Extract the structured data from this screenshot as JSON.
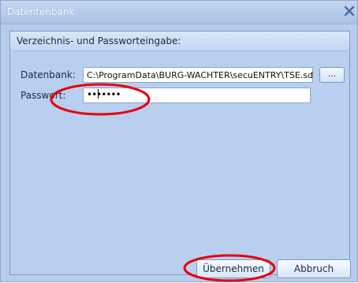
{
  "window": {
    "title": "Datentenbank",
    "close_icon": "close-icon"
  },
  "group": {
    "title": "Verzeichnis- und Passworteingabe:"
  },
  "form": {
    "database_label": "Datenbank:",
    "database_value": "C:\\ProgramData\\BURG-WACHTER\\secuENTRY\\TSE.sdf",
    "browse_label": "...",
    "password_label": "Passwort:",
    "password_value": "•••••••"
  },
  "buttons": {
    "ok_label": "Übernehmen",
    "cancel_label": "Abbruch"
  },
  "colors": {
    "annotation": "#e8000b",
    "window_bg": "#b7cdee"
  }
}
